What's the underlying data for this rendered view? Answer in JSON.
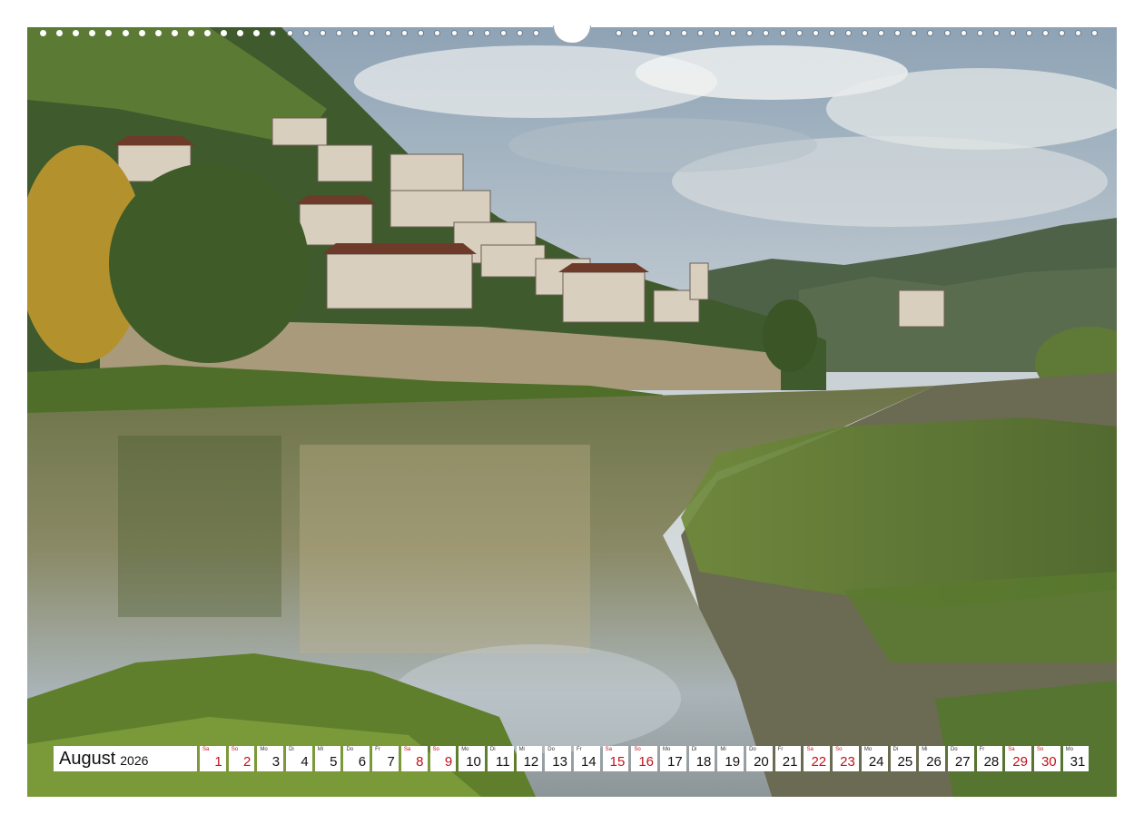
{
  "calendar": {
    "month": "August",
    "year": "2026",
    "days": [
      {
        "weekday": "Sa",
        "day": "1",
        "weekend": true
      },
      {
        "weekday": "So",
        "day": "2",
        "weekend": true
      },
      {
        "weekday": "Mo",
        "day": "3",
        "weekend": false
      },
      {
        "weekday": "Di",
        "day": "4",
        "weekend": false
      },
      {
        "weekday": "Mi",
        "day": "5",
        "weekend": false
      },
      {
        "weekday": "Do",
        "day": "6",
        "weekend": false
      },
      {
        "weekday": "Fr",
        "day": "7",
        "weekend": false
      },
      {
        "weekday": "Sa",
        "day": "8",
        "weekend": true
      },
      {
        "weekday": "So",
        "day": "9",
        "weekend": true
      },
      {
        "weekday": "Mo",
        "day": "10",
        "weekend": false
      },
      {
        "weekday": "Di",
        "day": "11",
        "weekend": false
      },
      {
        "weekday": "Mi",
        "day": "12",
        "weekend": false
      },
      {
        "weekday": "Do",
        "day": "13",
        "weekend": false
      },
      {
        "weekday": "Fr",
        "day": "14",
        "weekend": false
      },
      {
        "weekday": "Sa",
        "day": "15",
        "weekend": true
      },
      {
        "weekday": "So",
        "day": "16",
        "weekend": true
      },
      {
        "weekday": "Mo",
        "day": "17",
        "weekend": false
      },
      {
        "weekday": "Di",
        "day": "18",
        "weekend": false
      },
      {
        "weekday": "Mi",
        "day": "19",
        "weekend": false
      },
      {
        "weekday": "Do",
        "day": "20",
        "weekend": false
      },
      {
        "weekday": "Fr",
        "day": "21",
        "weekend": false
      },
      {
        "weekday": "Sa",
        "day": "22",
        "weekend": true
      },
      {
        "weekday": "So",
        "day": "23",
        "weekend": true
      },
      {
        "weekday": "Mo",
        "day": "24",
        "weekend": false
      },
      {
        "weekday": "Di",
        "day": "25",
        "weekend": false
      },
      {
        "weekday": "Mi",
        "day": "26",
        "weekend": false
      },
      {
        "weekday": "Do",
        "day": "27",
        "weekend": false
      },
      {
        "weekday": "Fr",
        "day": "28",
        "weekend": false
      },
      {
        "weekday": "Sa",
        "day": "29",
        "weekend": true
      },
      {
        "weekday": "So",
        "day": "30",
        "weekend": true
      },
      {
        "weekday": "Mo",
        "day": "31",
        "weekend": false
      }
    ]
  },
  "colors": {
    "weekend": "#c0121a",
    "weekday": "#111111",
    "cell_background": "#ffffff"
  }
}
